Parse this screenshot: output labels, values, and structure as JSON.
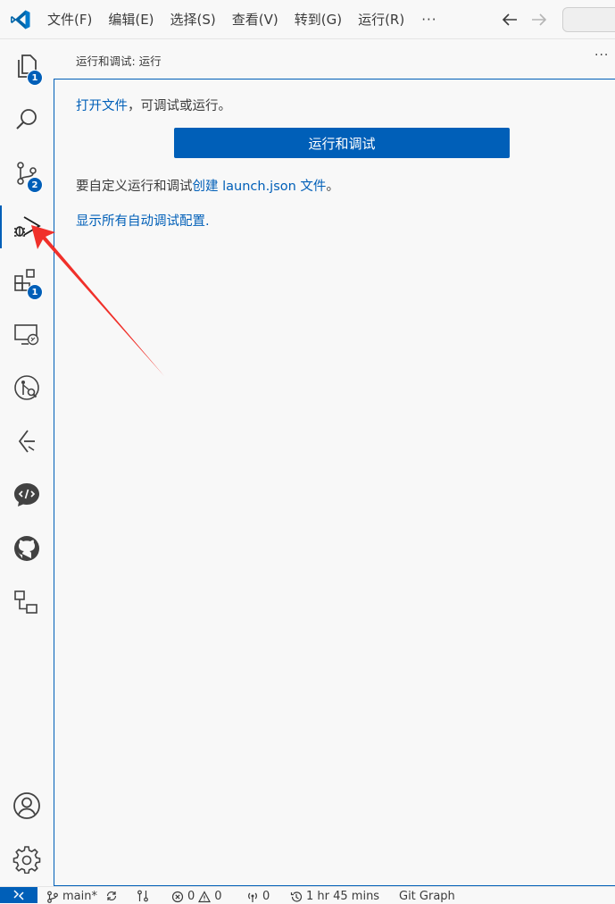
{
  "titlebar": {
    "menu": [
      "文件(F)",
      "编辑(E)",
      "选择(S)",
      "查看(V)",
      "转到(G)",
      "运行(R)"
    ],
    "more": "···"
  },
  "activitybar": {
    "explorer_badge": "1",
    "scm_badge": "2",
    "extensions_badge": "1"
  },
  "sidebar": {
    "title": "运行和调试: 运行",
    "more": "···",
    "open_file_link": "打开文件",
    "open_file_rest": "，可调试或运行。",
    "run_button": "运行和调试",
    "customize_prefix": "要自定义运行和调试",
    "create_launch_link": "创建 launch.json 文件",
    "customize_suffix": "。",
    "show_all_link": "显示所有自动调试配置."
  },
  "statusbar": {
    "branch": "main*",
    "errors": "0",
    "warnings": "0",
    "ports": "0",
    "time": "1 hr 45 mins",
    "git_graph": "Git Graph"
  },
  "colors": {
    "accent": "#005fb8",
    "annotation_arrow": "#f0302a"
  }
}
